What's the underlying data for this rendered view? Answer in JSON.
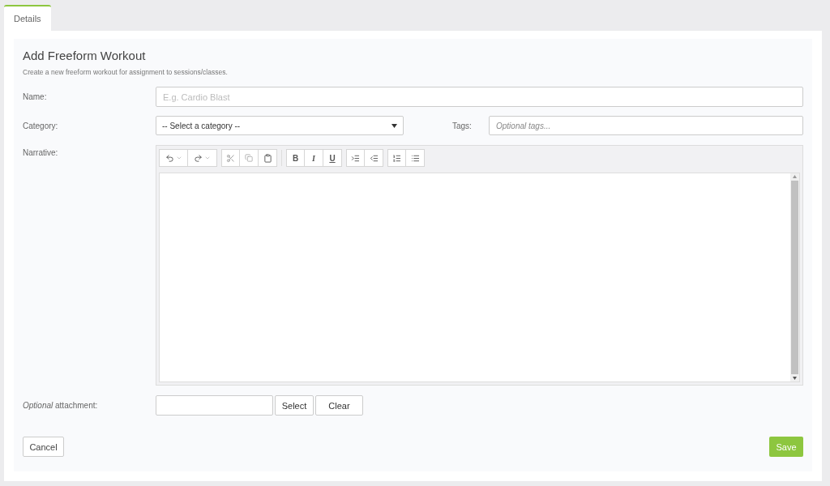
{
  "tabs": [
    {
      "label": "Details",
      "selected": true
    }
  ],
  "form": {
    "title": "Add Freeform Workout",
    "subtitle": "Create a new freeform workout for assignment to sessions/classes.",
    "name": {
      "label": "Name:",
      "placeholder": "E.g. Cardio Blast"
    },
    "category": {
      "label": "Category:",
      "value": "-- Select a category --"
    },
    "tags": {
      "label": "Tags:",
      "placeholder": "Optional tags..."
    },
    "narrative": {
      "label": "Narrative:",
      "format_buttons": [
        "B",
        "I",
        "U"
      ]
    },
    "attachment": {
      "label": "*Optional* attachment:",
      "buttons": [
        "Select",
        "Clear"
      ]
    },
    "cancel": "Cancel",
    "save": "Save"
  }
}
